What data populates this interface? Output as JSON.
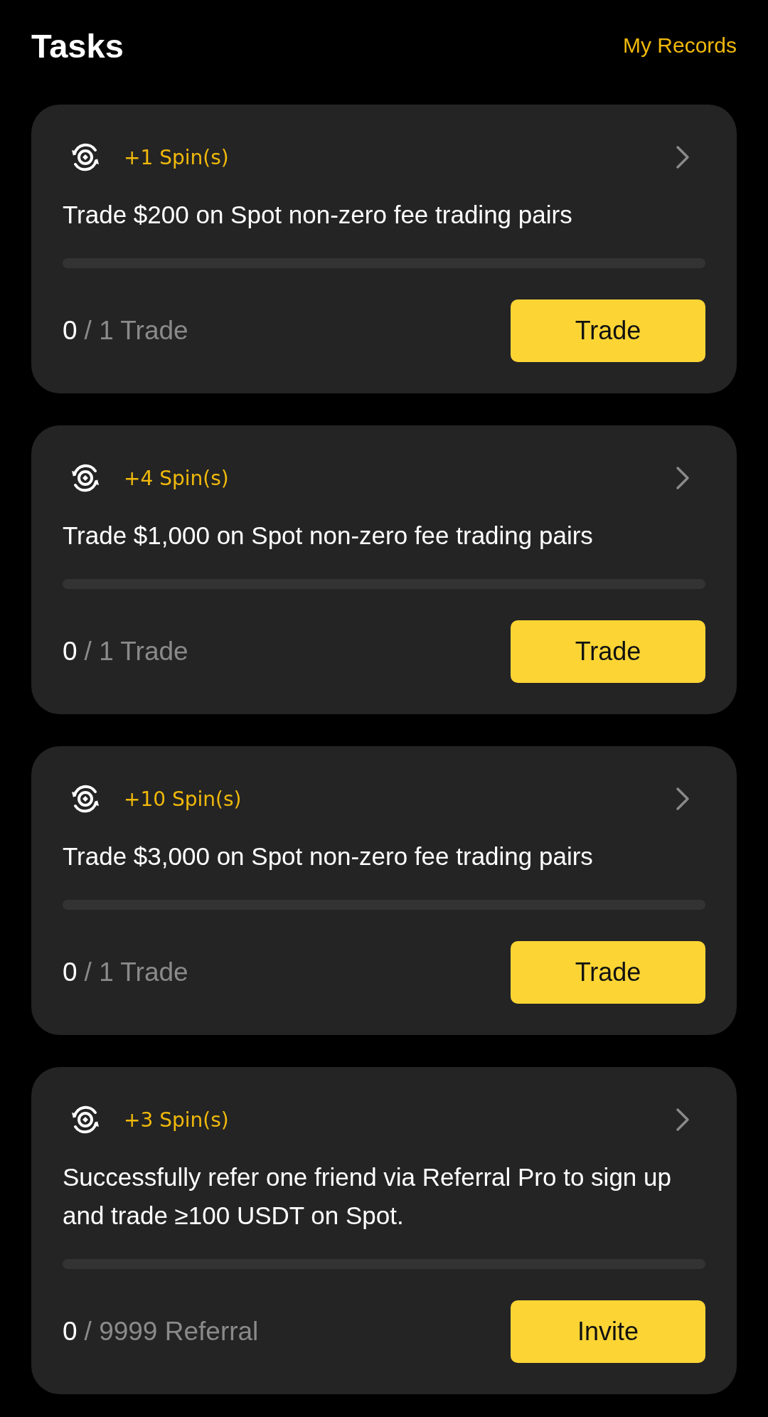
{
  "header": {
    "title": "Tasks",
    "link": "My Records"
  },
  "tasks": [
    {
      "reward": "+1 Spin(s)",
      "description": "Trade $200 on Spot non-zero fee trading pairs",
      "level": 0,
      "done": "0",
      "total": "/ 1 Trade",
      "button": "Trade"
    },
    {
      "reward": "+4 Spin(s)",
      "description": "Trade $1,000 on Spot non-zero fee trading pairs",
      "level": 0,
      "done": "0",
      "total": "/ 1 Trade",
      "button": "Trade"
    },
    {
      "reward": "+10 Spin(s)",
      "description": "Trade $3,000 on Spot non-zero fee trading pairs",
      "level": 0,
      "done": "0",
      "total": "/ 1 Trade",
      "button": "Trade"
    },
    {
      "reward": "+3 Spin(s)",
      "description": "Successfully refer one friend via Referral Pro to sign up and trade ≥100 USDT on Spot.",
      "level": 0,
      "done": "0",
      "total": "/ 9999 Referral",
      "button": "Invite"
    }
  ]
}
